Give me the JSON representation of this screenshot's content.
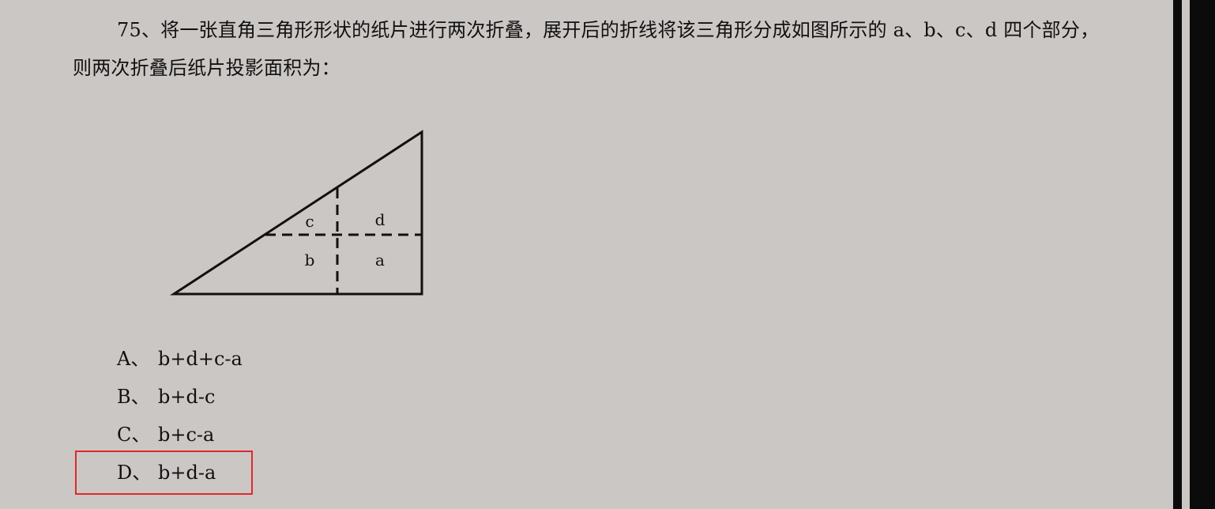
{
  "question": {
    "number": "75、",
    "text": "将一张直角三角形形状的纸片进行两次折叠，展开后的折线将该三角形分成如图所示的 a、b、c、d 四个部分，则两次折叠后纸片投影面积为："
  },
  "figure": {
    "labels": {
      "c": "c",
      "d": "d",
      "b": "b",
      "a": "a"
    }
  },
  "options": [
    {
      "letter": "A、",
      "text": "b+d+c-a"
    },
    {
      "letter": "B、",
      "text": "b+d-c"
    },
    {
      "letter": "C、",
      "text": "b+c-a"
    },
    {
      "letter": "D、",
      "text": "b+d-a"
    }
  ],
  "colors": {
    "background": "#cbc7c5",
    "answer_highlight": "#e0282b",
    "right_bar": "#0b0b0b"
  }
}
